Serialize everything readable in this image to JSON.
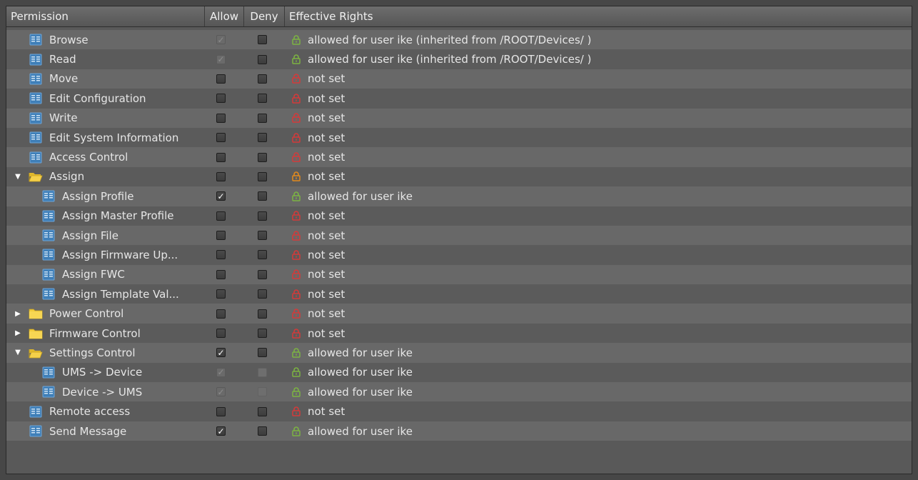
{
  "columns": {
    "permission": "Permission",
    "allow": "Allow",
    "deny": "Deny",
    "effective": "Effective Rights"
  },
  "colors": {
    "lock_red": "#d43a3a",
    "lock_green": "#7cb342",
    "lock_orange": "#e38a1c"
  },
  "rows": [
    {
      "label": "Browse",
      "level": 0,
      "type": "item",
      "allow": "checked",
      "allow_disabled": true,
      "deny": "unchecked",
      "deny_disabled": false,
      "lock": "green",
      "effective": "allowed for user ike (inherited from /ROOT/Devices/ )"
    },
    {
      "label": "Read",
      "level": 0,
      "type": "item",
      "allow": "checked",
      "allow_disabled": true,
      "deny": "unchecked",
      "deny_disabled": false,
      "lock": "green",
      "effective": "allowed for user ike (inherited from /ROOT/Devices/ )"
    },
    {
      "label": "Move",
      "level": 0,
      "type": "item",
      "allow": "unchecked",
      "allow_disabled": false,
      "deny": "unchecked",
      "deny_disabled": false,
      "lock": "red",
      "effective": "not set"
    },
    {
      "label": "Edit Configuration",
      "level": 0,
      "type": "item",
      "allow": "unchecked",
      "allow_disabled": false,
      "deny": "unchecked",
      "deny_disabled": false,
      "lock": "red",
      "effective": "not set"
    },
    {
      "label": "Write",
      "level": 0,
      "type": "item",
      "allow": "unchecked",
      "allow_disabled": false,
      "deny": "unchecked",
      "deny_disabled": false,
      "lock": "red",
      "effective": "not set"
    },
    {
      "label": "Edit System Information",
      "level": 0,
      "type": "item",
      "allow": "unchecked",
      "allow_disabled": false,
      "deny": "unchecked",
      "deny_disabled": false,
      "lock": "red",
      "effective": "not set"
    },
    {
      "label": "Access Control",
      "level": 0,
      "type": "item",
      "allow": "unchecked",
      "allow_disabled": false,
      "deny": "unchecked",
      "deny_disabled": false,
      "lock": "red",
      "effective": "not set"
    },
    {
      "label": "Assign",
      "level": 0,
      "type": "folder",
      "expanded": true,
      "allow": "unchecked",
      "allow_disabled": false,
      "deny": "unchecked",
      "deny_disabled": false,
      "lock": "orange",
      "effective": "not set"
    },
    {
      "label": "Assign Profile",
      "level": 1,
      "type": "item",
      "allow": "checked",
      "allow_disabled": false,
      "deny": "unchecked",
      "deny_disabled": false,
      "lock": "green",
      "effective": "allowed for user ike"
    },
    {
      "label": "Assign Master Profile",
      "level": 1,
      "type": "item",
      "allow": "unchecked",
      "allow_disabled": false,
      "deny": "unchecked",
      "deny_disabled": false,
      "lock": "red",
      "effective": "not set"
    },
    {
      "label": "Assign File",
      "level": 1,
      "type": "item",
      "allow": "unchecked",
      "allow_disabled": false,
      "deny": "unchecked",
      "deny_disabled": false,
      "lock": "red",
      "effective": "not set"
    },
    {
      "label": "Assign Firmware Up...",
      "level": 1,
      "type": "item",
      "allow": "unchecked",
      "allow_disabled": false,
      "deny": "unchecked",
      "deny_disabled": false,
      "lock": "red",
      "effective": "not set"
    },
    {
      "label": "Assign FWC",
      "level": 1,
      "type": "item",
      "allow": "unchecked",
      "allow_disabled": false,
      "deny": "unchecked",
      "deny_disabled": false,
      "lock": "red",
      "effective": "not set"
    },
    {
      "label": "Assign Template Val...",
      "level": 1,
      "type": "item",
      "allow": "unchecked",
      "allow_disabled": false,
      "deny": "unchecked",
      "deny_disabled": false,
      "lock": "red",
      "effective": "not set"
    },
    {
      "label": "Power Control",
      "level": 0,
      "type": "folder",
      "expanded": false,
      "allow": "unchecked",
      "allow_disabled": false,
      "deny": "unchecked",
      "deny_disabled": false,
      "lock": "red",
      "effective": "not set"
    },
    {
      "label": "Firmware Control",
      "level": 0,
      "type": "folder",
      "expanded": false,
      "allow": "unchecked",
      "allow_disabled": false,
      "deny": "unchecked",
      "deny_disabled": false,
      "lock": "red",
      "effective": "not set"
    },
    {
      "label": "Settings Control",
      "level": 0,
      "type": "folder",
      "expanded": true,
      "allow": "checked",
      "allow_disabled": false,
      "deny": "unchecked",
      "deny_disabled": false,
      "lock": "green",
      "effective": "allowed for user ike"
    },
    {
      "label": "UMS -> Device",
      "level": 1,
      "type": "item",
      "allow": "checked",
      "allow_disabled": true,
      "deny": "unchecked",
      "deny_disabled": true,
      "lock": "green",
      "effective": "allowed for user ike"
    },
    {
      "label": "Device -> UMS",
      "level": 1,
      "type": "item",
      "allow": "checked",
      "allow_disabled": true,
      "deny": "unchecked",
      "deny_disabled": true,
      "lock": "green",
      "effective": "allowed for user ike"
    },
    {
      "label": "Remote access",
      "level": 0,
      "type": "item",
      "allow": "unchecked",
      "allow_disabled": false,
      "deny": "unchecked",
      "deny_disabled": false,
      "lock": "red",
      "effective": "not set"
    },
    {
      "label": "Send Message",
      "level": 0,
      "type": "item",
      "allow": "checked",
      "allow_disabled": false,
      "deny": "unchecked",
      "deny_disabled": false,
      "lock": "green",
      "effective": "allowed for user ike"
    }
  ]
}
